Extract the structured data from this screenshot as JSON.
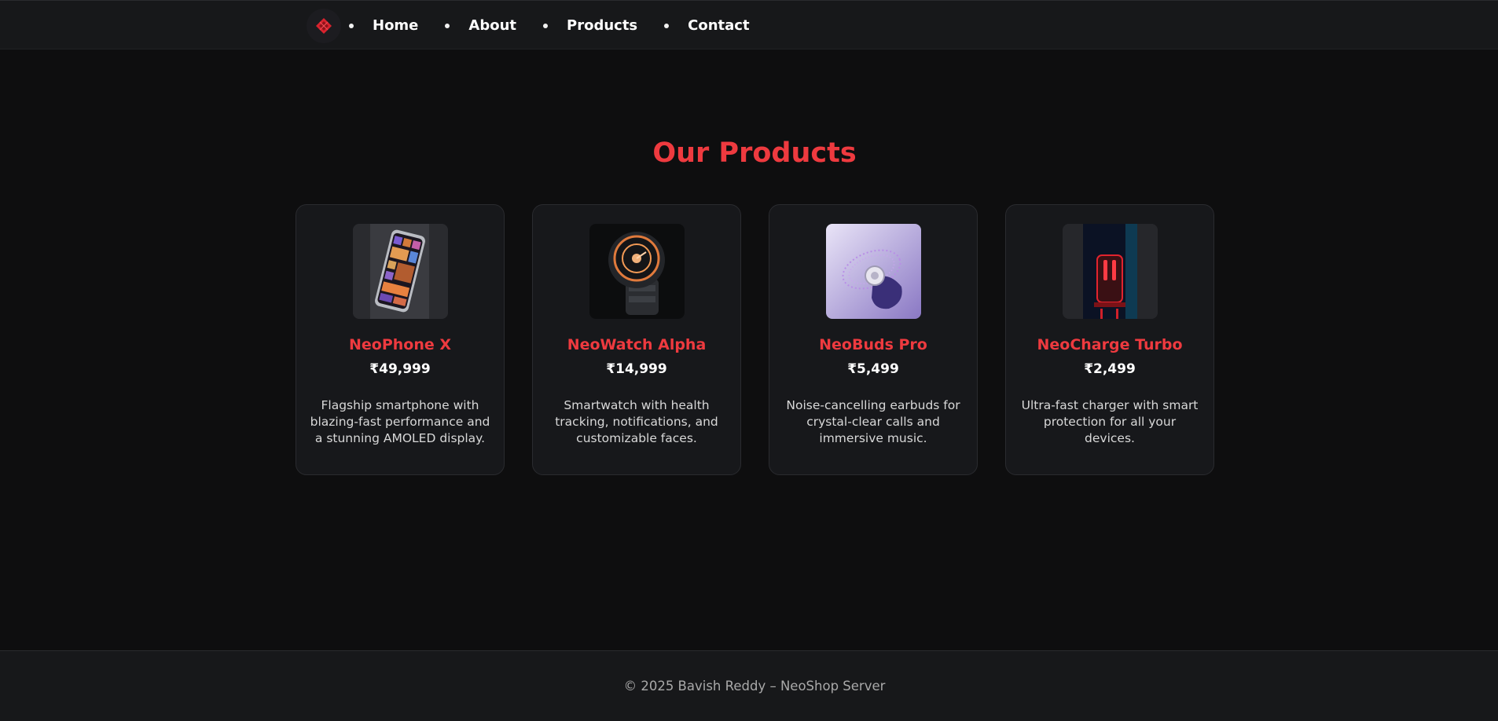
{
  "nav": {
    "logo_icon": "red-diamond-logo-icon",
    "items": [
      {
        "label": "Home"
      },
      {
        "label": "About"
      },
      {
        "label": "Products"
      },
      {
        "label": "Contact"
      }
    ]
  },
  "main": {
    "title": "Our Products",
    "products": [
      {
        "name": "NeoPhone X",
        "price": "₹49,999",
        "description": "Flagship smartphone with blazing-fast performance and a stunning AMOLED display.",
        "image_icon": "smartphone-image"
      },
      {
        "name": "NeoWatch Alpha",
        "price": "₹14,999",
        "description": "Smartwatch with health tracking, notifications, and customizable faces.",
        "image_icon": "smartwatch-image"
      },
      {
        "name": "NeoBuds Pro",
        "price": "₹5,499",
        "description": "Noise-cancelling earbuds for crystal-clear calls and immersive music.",
        "image_icon": "earbuds-image"
      },
      {
        "name": "NeoCharge Turbo",
        "price": "₹2,499",
        "description": "Ultra-fast charger with smart protection for all your devices.",
        "image_icon": "charger-image"
      }
    ]
  },
  "footer": {
    "text": "© 2025 Bavish Reddy – NeoShop Server"
  },
  "colors": {
    "accent": "#ee3a3f",
    "background": "#0e0e0f",
    "surface": "#17181b"
  }
}
